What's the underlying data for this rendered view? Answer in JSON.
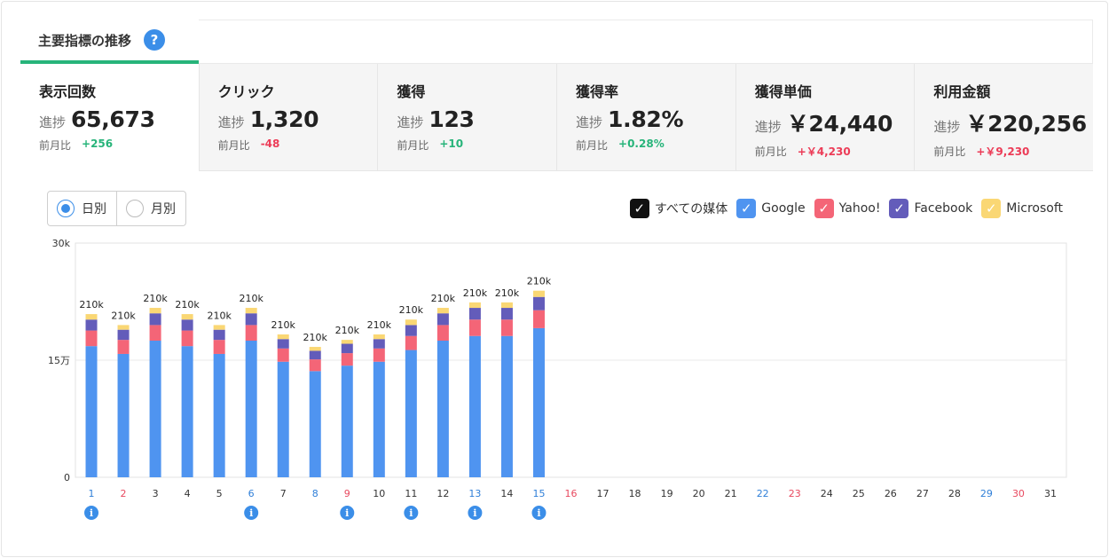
{
  "header": {
    "title": "主要指標の推移",
    "help": "?"
  },
  "kpis": [
    {
      "name": "表示回数",
      "progress_label": "進捗",
      "value": "65,673",
      "compare_label": "前月比",
      "delta": "+256",
      "trend": "up"
    },
    {
      "name": "クリック",
      "progress_label": "進捗",
      "value": "1,320",
      "compare_label": "前月比",
      "delta": "-48",
      "trend": "down"
    },
    {
      "name": "獲得",
      "progress_label": "進捗",
      "value": "123",
      "compare_label": "前月比",
      "delta": "+10",
      "trend": "up"
    },
    {
      "name": "獲得率",
      "progress_label": "進捗",
      "value": "1.82%",
      "compare_label": "前月比",
      "delta": "+0.28%",
      "trend": "up"
    },
    {
      "name": "獲得単価",
      "progress_label": "進捗",
      "value": "￥24,440",
      "compare_label": "前月比",
      "delta": "+￥4,230",
      "trend": "down"
    },
    {
      "name": "利用金額",
      "progress_label": "進捗",
      "value": "￥220,256",
      "compare_label": "前月比",
      "delta": "+￥9,230",
      "trend": "down"
    }
  ],
  "period_toggle": {
    "daily": "日別",
    "monthly": "月別",
    "selected": "daily"
  },
  "legend": [
    {
      "label": "すべての媒体",
      "color": "#111111"
    },
    {
      "label": "Google",
      "color": "#4f94f0"
    },
    {
      "label": "Yahoo!",
      "color": "#f46577"
    },
    {
      "label": "Facebook",
      "color": "#635cba"
    },
    {
      "label": "Microsoft",
      "color": "#fad774"
    }
  ],
  "chart_data": {
    "type": "bar",
    "stacked": true,
    "y_ticks": [
      "30k",
      "15万",
      "0"
    ],
    "ylim": [
      0,
      30000
    ],
    "categories": [
      "1",
      "2",
      "3",
      "4",
      "5",
      "6",
      "7",
      "8",
      "9",
      "10",
      "11",
      "12",
      "13",
      "14",
      "15",
      "16",
      "17",
      "18",
      "19",
      "20",
      "21",
      "22",
      "23",
      "24",
      "25",
      "26",
      "27",
      "28",
      "29",
      "30",
      "31"
    ],
    "category_colors": [
      "blue",
      "red",
      "",
      "",
      "",
      "blue",
      "",
      "blue",
      "red",
      "",
      "",
      "",
      "blue",
      "",
      "blue",
      "red",
      "",
      "",
      "",
      "",
      "",
      "blue",
      "red",
      "",
      "",
      "",
      "",
      "",
      "blue",
      "red",
      ""
    ],
    "info_marker_days": [
      1,
      6,
      9,
      11,
      13,
      15
    ],
    "series": [
      {
        "name": "Google",
        "color": "#4f94f0",
        "values": [
          16800,
          15800,
          17500,
          16800,
          15800,
          17500,
          14800,
          13600,
          14300,
          14800,
          16300,
          17500,
          18100,
          18100,
          19100
        ]
      },
      {
        "name": "Yahoo!",
        "color": "#f46577",
        "values": [
          2000,
          1800,
          2000,
          2000,
          1800,
          2000,
          1700,
          1500,
          1600,
          1700,
          1800,
          2000,
          2100,
          2100,
          2300
        ]
      },
      {
        "name": "Facebook",
        "color": "#635cba",
        "values": [
          1400,
          1300,
          1500,
          1400,
          1300,
          1500,
          1200,
          1100,
          1200,
          1200,
          1400,
          1500,
          1500,
          1500,
          1700
        ]
      },
      {
        "name": "Microsoft",
        "color": "#fad774",
        "values": [
          700,
          600,
          700,
          700,
          600,
          700,
          600,
          500,
          500,
          600,
          700,
          700,
          700,
          700,
          800
        ]
      }
    ],
    "total_labels": [
      "210k",
      "210k",
      "210k",
      "210k",
      "210k",
      "210k",
      "210k",
      "210k",
      "210k",
      "210k",
      "210k",
      "210k",
      "210k",
      "210k",
      "210k"
    ],
    "info_icon": "i",
    "grid": true
  }
}
